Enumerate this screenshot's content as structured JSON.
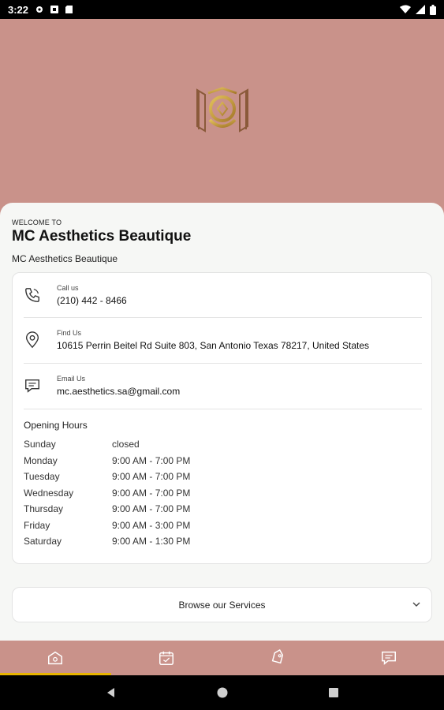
{
  "status": {
    "time": "3:22"
  },
  "welcome_label": "WELCOME TO",
  "business_name": "MC Aesthetics Beautique",
  "business_subtitle": "MC Aesthetics Beautique",
  "contact": {
    "phone": {
      "label": "Call us",
      "value": "(210) 442 - 8466"
    },
    "address": {
      "label": "Find Us",
      "value": "10615 Perrin Beitel Rd Suite 803, San Antonio  Texas 78217, United States"
    },
    "email": {
      "label": "Email Us",
      "value": "mc.aesthetics.sa@gmail.com"
    }
  },
  "hours": {
    "title": "Opening Hours",
    "rows": [
      {
        "day": "Sunday",
        "time": "closed"
      },
      {
        "day": "Monday",
        "time": "9:00 AM - 7:00 PM"
      },
      {
        "day": "Tuesday",
        "time": "9:00 AM - 7:00 PM"
      },
      {
        "day": "Wednesday",
        "time": "9:00 AM - 7:00 PM"
      },
      {
        "day": "Thursday",
        "time": "9:00 AM - 7:00 PM"
      },
      {
        "day": "Friday",
        "time": "9:00 AM - 3:00 PM"
      },
      {
        "day": "Saturday",
        "time": "9:00 AM - 1:30 PM"
      }
    ]
  },
  "browse_label": "Browse our Services",
  "tabs": [
    {
      "icon": "home-icon",
      "active": true
    },
    {
      "icon": "calendar-icon",
      "active": false
    },
    {
      "icon": "tag-icon",
      "active": false
    },
    {
      "icon": "chat-icon",
      "active": false
    }
  ],
  "colors": {
    "brand": "#c9928a",
    "gold": "#c9a227",
    "tab_indicator": "#e8b400"
  }
}
